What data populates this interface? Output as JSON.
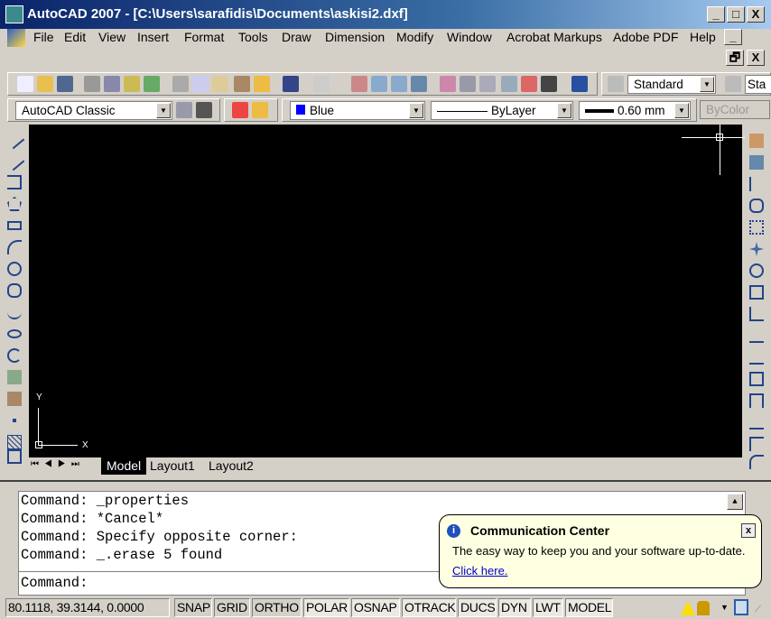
{
  "window": {
    "title": "AutoCAD 2007 - [C:\\Users\\sarafidis\\Documents\\askisi2.dxf]",
    "minimize": "_",
    "maximize": "□",
    "close": "X",
    "doc_minimize": "_",
    "doc_restore": "🗗",
    "doc_close": "X"
  },
  "menu": [
    "File",
    "Edit",
    "View",
    "Insert",
    "Format",
    "Tools",
    "Draw",
    "Dimension",
    "Modify",
    "Window",
    "Acrobat Markups",
    "Adobe PDF",
    "Help"
  ],
  "toolbar": {
    "text_style": "Standard",
    "dim_style": "Sta",
    "workspace": "AutoCAD Classic",
    "color": "Blue",
    "color_hex": "#0000ff",
    "linetype": "ByLayer",
    "lineweight": "0.60 mm",
    "plot_style": "ByColor"
  },
  "ucs": {
    "x": "X",
    "y": "Y"
  },
  "tabs": [
    "Model",
    "Layout1",
    "Layout2"
  ],
  "command": {
    "history": [
      "Command:  _properties",
      "Command: *Cancel*",
      "Command: Specify opposite corner:",
      "Command:  _.erase 5 found"
    ],
    "prompt": "Command:"
  },
  "status": {
    "coords": "80.1118,  39.3144, 0.0000",
    "toggles": [
      {
        "label": "SNAP",
        "on": false
      },
      {
        "label": "GRID",
        "on": false
      },
      {
        "label": "ORTHO",
        "on": false
      },
      {
        "label": "POLAR",
        "on": true
      },
      {
        "label": "OSNAP",
        "on": true
      },
      {
        "label": "OTRACK",
        "on": true
      },
      {
        "label": "DUCS",
        "on": true
      },
      {
        "label": "DYN",
        "on": true
      },
      {
        "label": "LWT",
        "on": true
      },
      {
        "label": "MODEL",
        "on": true
      }
    ]
  },
  "bubble": {
    "title": "Communication Center",
    "text": "The easy way to keep you and your software up-to-date.",
    "link": "Click here.",
    "close": "x"
  }
}
